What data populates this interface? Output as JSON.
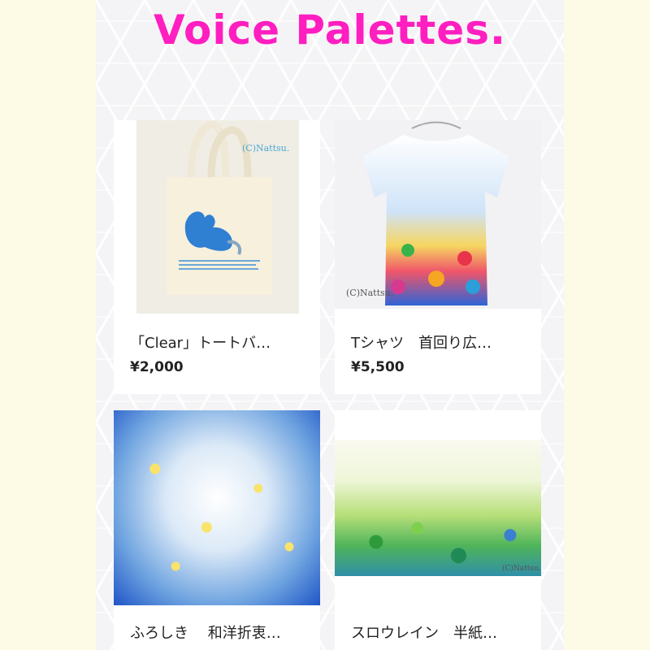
{
  "shop": {
    "title": "Voice Palettes."
  },
  "products": [
    {
      "name": "「Clear」トートバ…",
      "price": "¥2,000",
      "watermark": "(C)Nattsu.",
      "icon": "tote-bag-image"
    },
    {
      "name": "Tシャツ　首回り広…",
      "price": "¥5,500",
      "watermark": "(C)Nattsu.",
      "icon": "tshirt-image"
    },
    {
      "name": "ふろしき　 和洋折衷…",
      "price": "",
      "icon": "furoshiki-image"
    },
    {
      "name": "スロウレイン　半紙…",
      "price": "",
      "watermark": "(C)Nattsu.",
      "icon": "painting-image"
    }
  ],
  "colors": {
    "title": "#ff1ec0",
    "background": "#fdfbe6",
    "card": "#ffffff"
  }
}
